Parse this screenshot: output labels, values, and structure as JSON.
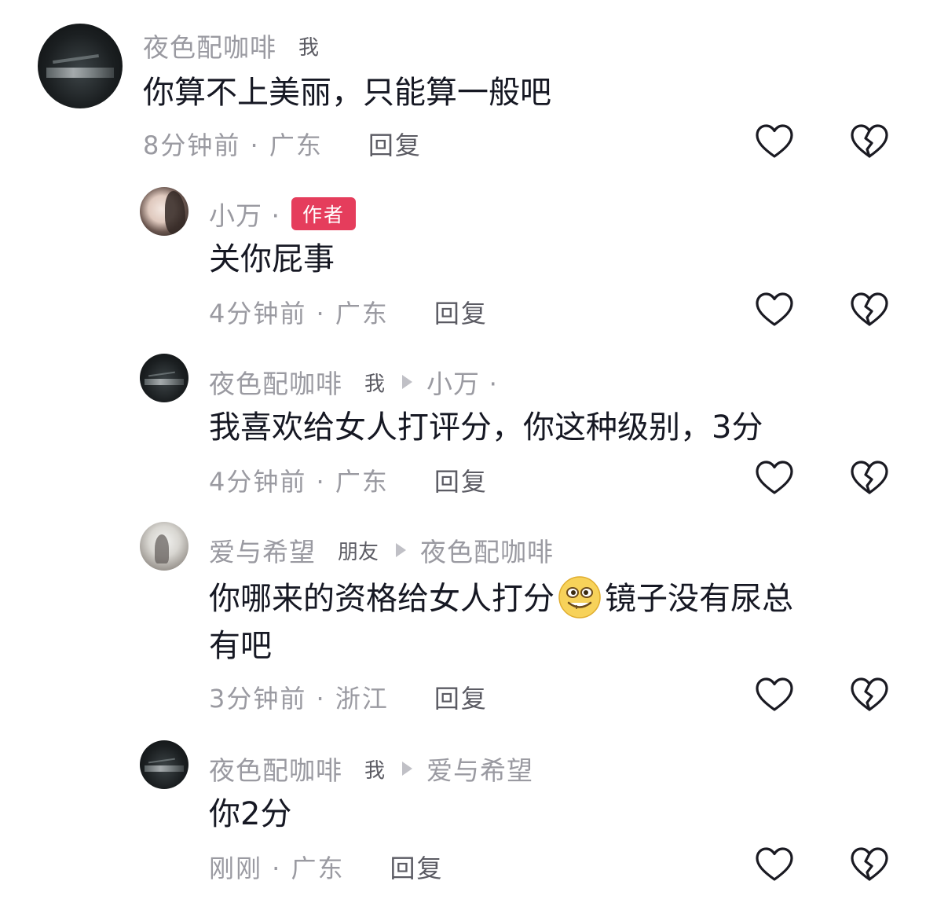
{
  "comments": [
    {
      "username": "夜色配咖啡",
      "tag": "我",
      "text": "你算不上美丽，只能算一般吧",
      "time": "8分钟前 · 广东",
      "reply_label": "回复"
    },
    {
      "username": "小万 ·",
      "badge": "作者",
      "text": "关你屁事",
      "time": "4分钟前 · 广东",
      "reply_label": "回复"
    },
    {
      "username": "夜色配咖啡",
      "tag": "我",
      "reply_to": "小万 ·",
      "text": "我喜欢给女人打评分，你这种级别，3分",
      "time": "4分钟前 · 广东",
      "reply_label": "回复"
    },
    {
      "username": "爱与希望",
      "tag": "朋友",
      "reply_to": "夜色配咖啡",
      "text_before_emoji": "你哪来的资格给女人打分",
      "emoji": "grin-emoji",
      "text_after_emoji": "镜子没有尿总",
      "text_line2": "有吧",
      "time": "3分钟前 · 浙江",
      "reply_label": "回复"
    },
    {
      "username": "夜色配咖啡",
      "tag": "我",
      "reply_to": "爱与希望",
      "text": "你2分",
      "time": "刚刚 · 广东",
      "reply_label": "回复"
    }
  ],
  "icons": {
    "like": "heart-outline-icon",
    "dislike": "broken-heart-icon",
    "reply_arrow": "play-arrow-icon"
  }
}
